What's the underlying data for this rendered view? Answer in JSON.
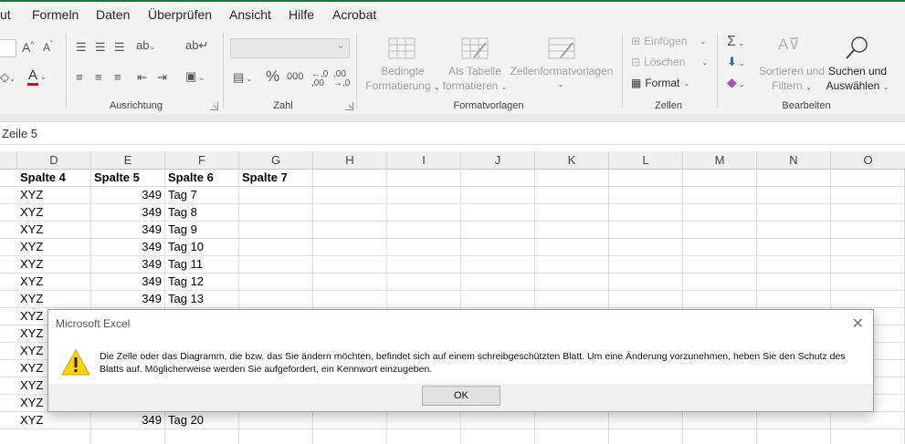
{
  "tabs": [
    "ut",
    "Formeln",
    "Daten",
    "Überprüfen",
    "Ansicht",
    "Hilfe",
    "Acrobat"
  ],
  "ribbon": {
    "groups": {
      "alignment": "Ausrichtung",
      "number": "Zahl",
      "styles": "Formatvorlagen",
      "cells": "Zellen",
      "editing": "Bearbeiten"
    },
    "styles": {
      "conditional_line1": "Bedingte",
      "conditional_line2": "Formatierung",
      "as_table_line1": "Als Tabelle",
      "as_table_line2": "formatieren",
      "cell_styles": "Zellenformatvorlagen"
    },
    "cells": {
      "insert": "Einfügen",
      "delete": "Löschen",
      "format": "Format"
    },
    "editing": {
      "sort_line1": "Sortieren und",
      "sort_line2": "Filtern",
      "find_line1": "Suchen und",
      "find_line2": "Auswählen"
    },
    "number": {
      "percent": "%",
      "thousands": "000"
    }
  },
  "name_box": "Zeile 5",
  "columns": [
    "D",
    "E",
    "F",
    "G",
    "H",
    "I",
    "J",
    "K",
    "L",
    "M",
    "N",
    "O"
  ],
  "header_row": [
    "Spalte 4",
    "Spalte 5",
    "Spalte 6",
    "Spalte 7"
  ],
  "rows": [
    [
      "XYZ",
      "349",
      "Tag 7"
    ],
    [
      "XYZ",
      "349",
      "Tag 8"
    ],
    [
      "XYZ",
      "349",
      "Tag 9"
    ],
    [
      "XYZ",
      "349",
      "Tag 10"
    ],
    [
      "XYZ",
      "349",
      "Tag 11"
    ],
    [
      "XYZ",
      "349",
      "Tag 12"
    ],
    [
      "XYZ",
      "349",
      "Tag 13"
    ],
    [
      "XYZ",
      "",
      ""
    ],
    [
      "XYZ",
      "",
      ""
    ],
    [
      "XYZ",
      "",
      ""
    ],
    [
      "XYZ",
      "",
      ""
    ],
    [
      "XYZ",
      "",
      ""
    ],
    [
      "XYZ",
      "",
      ""
    ],
    [
      "XYZ",
      "349",
      "Tag 20"
    ],
    [
      "",
      "",
      ""
    ]
  ],
  "dialog": {
    "title": "Microsoft Excel",
    "message": "Die Zelle oder das Diagramm, die bzw. das Sie ändern möchten, befindet sich auf einem schreibgeschützten Blatt. Um eine Änderung vorzunehmen, heben Sie den Schutz des Blatts auf. Möglicherweise werden Sie aufgefordert, ein Kennwort einzugeben.",
    "ok_label": "OK"
  },
  "colors": {
    "accent": "#217346",
    "warning": "#fcd116",
    "ribbon_bg": "#f3f3f3"
  }
}
